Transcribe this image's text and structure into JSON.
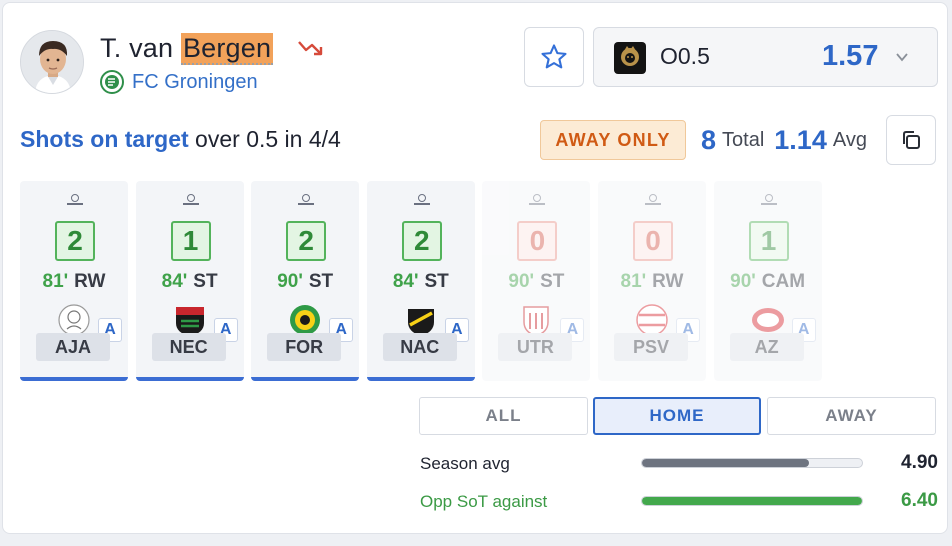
{
  "player": {
    "first": "T. van ",
    "last": "Bergen",
    "team": "FC Groningen",
    "trend_icon": "trend-down-icon"
  },
  "odds": {
    "line": "O0.5",
    "price": "1.57"
  },
  "prop": {
    "stat": "Shots on target",
    "rest": " over 0.5 in 4/4"
  },
  "badge": "AWAY ONLY",
  "totals": {
    "total_value": "8",
    "total_label": "Total",
    "avg_value": "1.14",
    "avg_label": "Avg"
  },
  "games": [
    {
      "value": "2",
      "minutes": "81'",
      "position": "RW",
      "venue": "A",
      "opponent": "AJA",
      "hit": true
    },
    {
      "value": "1",
      "minutes": "84'",
      "position": "ST",
      "venue": "A",
      "opponent": "NEC",
      "hit": true
    },
    {
      "value": "2",
      "minutes": "90'",
      "position": "ST",
      "venue": "A",
      "opponent": "FOR",
      "hit": true
    },
    {
      "value": "2",
      "minutes": "84'",
      "position": "ST",
      "venue": "A",
      "opponent": "NAC",
      "hit": true
    },
    {
      "value": "0",
      "minutes": "90'",
      "position": "ST",
      "venue": "A",
      "opponent": "UTR",
      "hit": false
    },
    {
      "value": "0",
      "minutes": "81'",
      "position": "RW",
      "venue": "A",
      "opponent": "PSV",
      "hit": false
    },
    {
      "value": "1",
      "minutes": "90'",
      "position": "CAM",
      "venue": "A",
      "opponent": "AZ",
      "hit": false
    }
  ],
  "filters": {
    "all": "ALL",
    "home": "HOME",
    "away": "AWAY",
    "active": "HOME"
  },
  "metrics": [
    {
      "label": "Season avg",
      "value": "4.90",
      "fill_fraction": 0.76,
      "color": "#1f2330",
      "bar_color": "#6e7480"
    },
    {
      "label": "Opp SoT against",
      "value": "6.40",
      "fill_fraction": 1.0,
      "color": "#3b9a45",
      "bar_color": "#43a84c"
    }
  ],
  "colors": {
    "accent": "#2e67c7",
    "highlight": "#f2a25a",
    "badge_text": "#d05a14"
  }
}
